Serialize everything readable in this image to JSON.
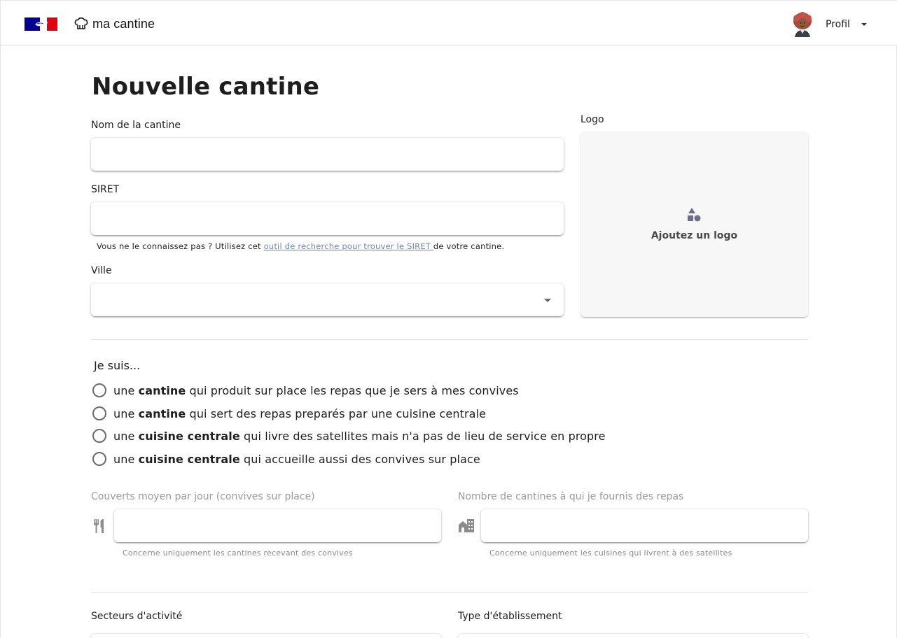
{
  "header": {
    "brand": "ma cantine",
    "profile_label": "Profil",
    "flag_colors": [
      "#000091",
      "#ffffff",
      "#e1000f"
    ]
  },
  "page": {
    "title": "Nouvelle cantine"
  },
  "form": {
    "name": {
      "label": "Nom de la cantine",
      "value": ""
    },
    "siret": {
      "label": "SIRET",
      "value": "",
      "hint_before": "Vous ne le connaissez pas ? Utilisez cet ",
      "hint_link": "outil de recherche pour trouver le SIRET ",
      "hint_after": "de votre cantine."
    },
    "city": {
      "label": "Ville",
      "value": ""
    },
    "logo": {
      "label": "Logo",
      "cta": "Ajoutez un logo",
      "icon": "shapes-icon"
    },
    "production_type": {
      "title": "Je suis...",
      "options": [
        {
          "pre": "une ",
          "bold": "cantine",
          "post": " qui produit sur place les repas que je sers à mes convives"
        },
        {
          "pre": "une ",
          "bold": "cantine",
          "post": " qui sert des repas preparés par une cuisine centrale"
        },
        {
          "pre": "une ",
          "bold": "cuisine centrale",
          "post": " qui livre des satellites mais n'a pas de lieu de service en propre"
        },
        {
          "pre": "une ",
          "bold": "cuisine centrale",
          "post": " qui accueille aussi des convives sur place"
        }
      ]
    },
    "daily_meals": {
      "label": "Couverts moyen par jour (convives sur place)",
      "hint": "Concerne uniquement les cantines recevant des convives",
      "icon": "cutlery-icon"
    },
    "satellites": {
      "label": "Nombre de cantines à qui je fournis des repas",
      "hint": "Concerne uniquement les cuisines qui livrent à des satellites",
      "icon": "buildings-icon"
    },
    "sectors": {
      "label": "Secteurs d'activité"
    },
    "establishment_type": {
      "label": "Type d'établissement"
    }
  }
}
